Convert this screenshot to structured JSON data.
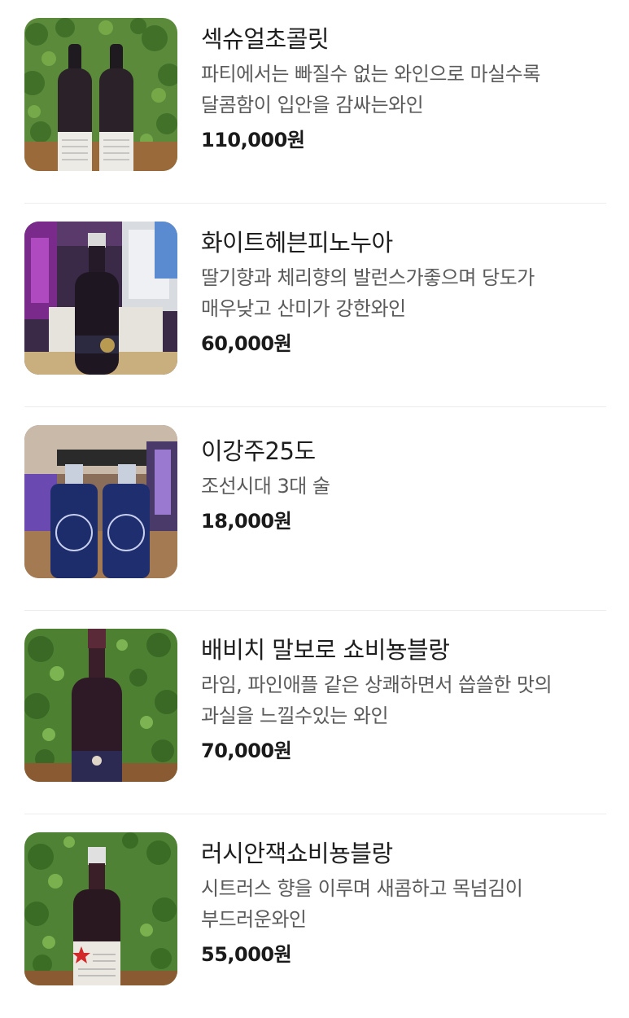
{
  "items": [
    {
      "name": "섹슈얼초콜릿",
      "description": "파티에서는 빠질수 없는 와인으로 마실수록 달콤함이 입안을 감싸는와인",
      "price": "110,000원",
      "image": "two-red-wine-bottles-photo"
    },
    {
      "name": "화이트헤븐피노누아",
      "description": "딸기향과 체리향의 발런스가좋으며 당도가 매우낮고 산미가 강한와인",
      "price": "60,000원",
      "image": "pinot-noir-bottle-photo"
    },
    {
      "name": "이강주25도",
      "description": "조선시대 3대 술",
      "price": "18,000원",
      "image": "two-blue-liquor-bottles-photo"
    },
    {
      "name": "배비치 말보로 쇼비뇽블랑",
      "description": "라임, 파인애플 같은 상쾌하면서 씁쓸한 맛의 과실을 느낄수있는 와인",
      "price": "70,000원",
      "image": "babich-wine-bottle-photo"
    },
    {
      "name": "러시안잭쇼비뇽블랑",
      "description": "시트러스 향을 이루며 새콤하고 목넘김이 부드러운와인",
      "price": "55,000원",
      "image": "russian-jack-wine-bottle-photo"
    }
  ]
}
